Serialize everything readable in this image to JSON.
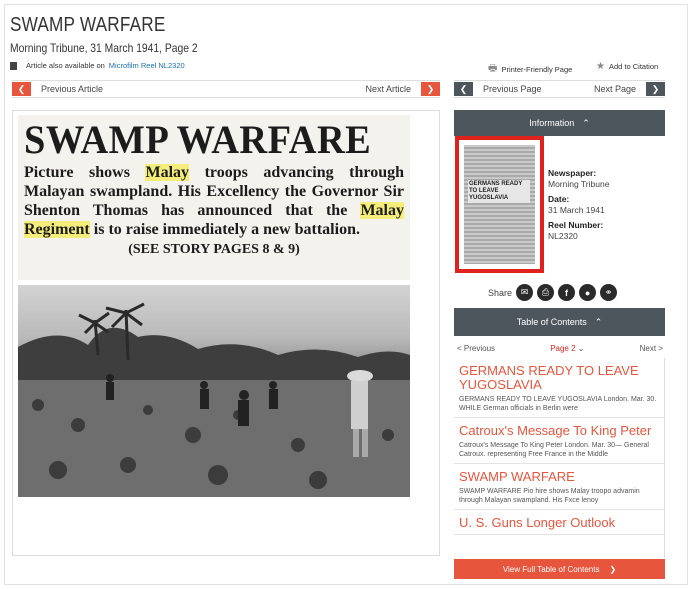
{
  "article": {
    "title": "SWAMP WARFARE",
    "subtitle": "Morning Tribune, 31 March 1941, Page 2",
    "reel_note": "Article also available on",
    "reel_link": "Microfilm Reel NL2320"
  },
  "tools": {
    "printer_friendly": "Printer-Friendly Page",
    "add_citation": "Add to Citation"
  },
  "nav": {
    "prev_article": "Previous Article",
    "next_article": "Next Article",
    "prev_page": "Previous Page",
    "next_page": "Next Page"
  },
  "clipping": {
    "headline": "SWAMP WARFARE",
    "body": [
      {
        "t": "Picture shows "
      },
      {
        "t": "Malay",
        "hl": true
      },
      {
        "t": " troops advancing through Malayan swampland. His Excellency the Governor Sir Shenton Thomas has announced that the "
      },
      {
        "t": "Malay Regiment",
        "hl": true
      },
      {
        "t": " is to raise immediately a new battalion."
      }
    ],
    "story_ref": "(SEE STORY PAGES 8 & 9)"
  },
  "info": {
    "header": "Information",
    "newspaper_label": "Newspaper:",
    "newspaper_value": "Morning Tribune",
    "date_label": "Date:",
    "date_value": "31 March 1941",
    "reel_label": "Reel Number:",
    "reel_value": "NL2320",
    "thumb_headline": "GERMANS READY TO LEAVE YUGOSLAVIA"
  },
  "share": {
    "label": "Share",
    "icons": [
      "email-icon",
      "print-icon",
      "facebook-icon",
      "twitter-icon",
      "link-icon"
    ]
  },
  "toc": {
    "header": "Table of Contents",
    "prev": "< Previous",
    "page": "Page 2",
    "next": "Next >",
    "items": [
      {
        "title": "GERMANS READY TO LEAVE YUGOSLAVIA",
        "snippet": "GERMANS READY TO LEAVE YUGOSLAVIA London. Mar. 30. WHILE German officials in Berlin were"
      },
      {
        "title": "Catroux's Message To King Peter",
        "snippet": "Catroux's Message To King Peter London. Mar. 30— General Catroux. representing Free France in the Middle"
      },
      {
        "title": "SWAMP WARFARE",
        "snippet": "SWAMP WARFARE Pio hire shows Malay troopo advamin through Malayan swampland. His Fxce lenoy"
      },
      {
        "title": "U. S. Guns Longer Outlook",
        "snippet": ""
      }
    ],
    "full_button": "View Full Table of Contents"
  },
  "colors": {
    "accent": "#e8553d",
    "dark": "#4d555d",
    "highlight": "#f5ed7a",
    "link": "#1a6fb0"
  }
}
